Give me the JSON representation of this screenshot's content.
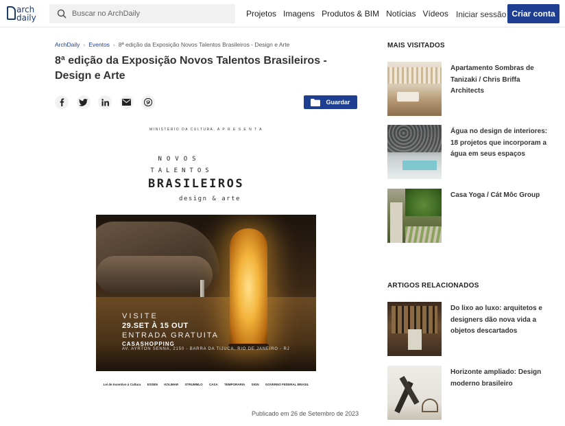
{
  "header": {
    "logo": {
      "line1": "arch",
      "line2": "daily"
    },
    "search_placeholder": "Buscar no ArchDaily",
    "nav": [
      "Projetos",
      "Imagens",
      "Produtos & BIM",
      "Notícias",
      "Vídeos"
    ],
    "login": "Iniciar sessão",
    "create_account": "Criar conta",
    "accent_color": "#1d3e91"
  },
  "breadcrumb": {
    "home": "ArchDaily",
    "section": "Eventos",
    "current": "8ª edição da Exposição Novos Talentos Brasileiros - Design e Arte"
  },
  "article": {
    "title": "8ª edição da Exposição Novos Talentos Brasileiros - Design e Arte",
    "share_icons": [
      "facebook-icon",
      "twitter-icon",
      "linkedin-icon",
      "email-icon",
      "pinterest-icon"
    ],
    "save_label": "Guardar",
    "published": "Publicado em 26 de Setembro de 2023"
  },
  "poster": {
    "ministry": "MINISTÉRIO DA CULTURA, A P R E S E N T A",
    "novos": "NOVOS",
    "talentos": "TALENTOS",
    "brasileiros": "BRASILEIROS",
    "design": "design & arte",
    "visite": "VISITE",
    "dates": "29.SET À 15 OUT",
    "entrada": "ENTRADA GRATUITA",
    "venue": "CASASHOPPING",
    "address": "AV. AYRTON SENNA, 2150 - BARRA DA TIJUCA, RIO DE JANEIRO - RJ",
    "sponsors": [
      "Lei de Incentivo à Cultura",
      "ESSEN",
      "KOLIMAR",
      "STRUMMLO",
      "CASA",
      "TEMPORARIA",
      "SIGN",
      "GOVERNO FEDERAL BRASIL"
    ]
  },
  "sidebar": {
    "most_visited_title": "MAIS VISITADOS",
    "most_visited": [
      {
        "title": "Apartamento Sombras de Tanizaki / Chris Briffa Architects"
      },
      {
        "title": "Água no design de interiores: 18 projetos que incorporam a água em seus espaços"
      },
      {
        "title": "Casa Yoga / Cát Môc Group"
      }
    ],
    "related_title": "ARTIGOS RELACIONADOS",
    "related": [
      {
        "title": "Do lixo ao luxo: arquitetos e designers dão nova vida a objetos descartados"
      },
      {
        "title": "Horizonte ampliado: Design moderno brasileiro"
      }
    ]
  }
}
